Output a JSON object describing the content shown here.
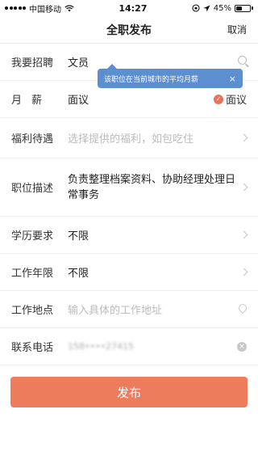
{
  "status_bar": {
    "carrier": "中国移动",
    "time": "14:27",
    "battery_percent": "45%",
    "battery_level": 0.45
  },
  "nav": {
    "title": "全职发布",
    "cancel_label": "取消"
  },
  "form": {
    "position": {
      "label": "我要招聘",
      "value": "文员"
    },
    "tooltip": {
      "text": "该职位在当前城市的平均月薪",
      "close": "×"
    },
    "salary": {
      "label": "月薪",
      "value": "面议",
      "negotiable_label": "面议",
      "negotiable_checked": true
    },
    "benefits": {
      "label": "福利待遇",
      "placeholder": "选择提供的福利，如包吃住"
    },
    "description": {
      "label": "职位描述",
      "value": "负责整理档案资料、协助经理处理日常事务"
    },
    "education": {
      "label": "学历要求",
      "value": "不限"
    },
    "experience": {
      "label": "工作年限",
      "value": "不限"
    },
    "location": {
      "label": "工作地点",
      "placeholder": "输入具体的工作地址"
    },
    "phone": {
      "label": "联系电话",
      "value": "158••••27415"
    }
  },
  "submit_label": "发布",
  "colors": {
    "accent": "#ec7c5c",
    "tooltip": "#5b8fd0"
  }
}
